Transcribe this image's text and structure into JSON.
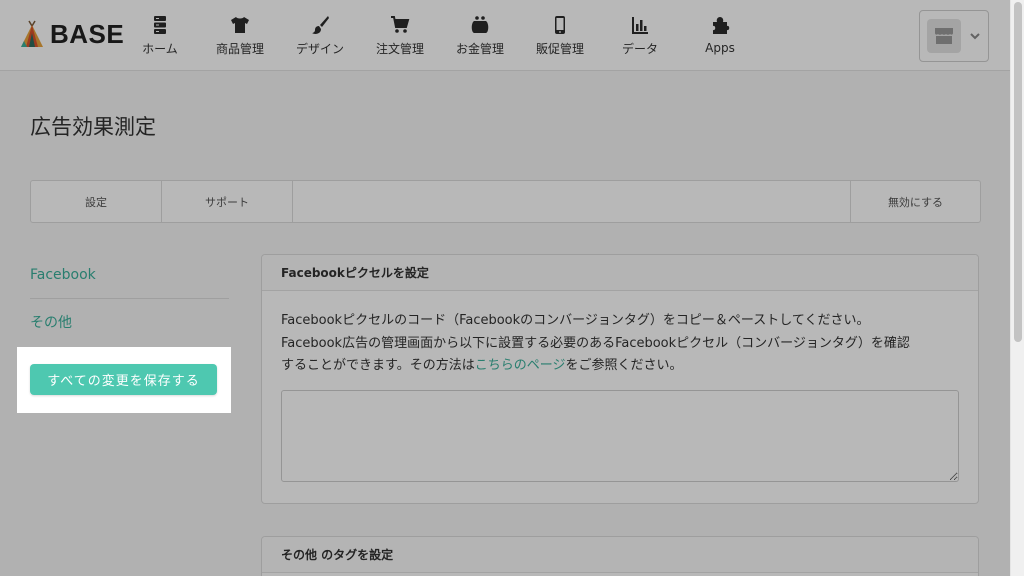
{
  "brand": {
    "name": "BASE"
  },
  "nav": {
    "items": [
      {
        "label": "ホーム",
        "icon": "server-stack-icon"
      },
      {
        "label": "商品管理",
        "icon": "tshirt-icon"
      },
      {
        "label": "デザイン",
        "icon": "paintbrush-icon"
      },
      {
        "label": "注文管理",
        "icon": "cart-icon"
      },
      {
        "label": "お金管理",
        "icon": "purse-icon"
      },
      {
        "label": "販促管理",
        "icon": "smartphone-icon"
      },
      {
        "label": "データ",
        "icon": "bar-chart-icon"
      },
      {
        "label": "Apps",
        "icon": "puzzle-icon"
      }
    ],
    "shop_icon": "storefront-icon"
  },
  "page": {
    "title": "広告効果測定"
  },
  "tabs": {
    "settings": "設定",
    "support": "サポート",
    "disable": "無効にする"
  },
  "sidebar": {
    "items": [
      "Facebook",
      "その他"
    ]
  },
  "save_button": {
    "label": "すべての変更を保存する"
  },
  "panel_facebook": {
    "title": "Facebookピクセルを設定",
    "line1": "Facebookピクセルのコード（Facebookのコンバージョンタグ）をコピー＆ペーストしてください。",
    "line2": "Facebook広告の管理画面から以下に設置する必要のあるFacebookピクセル（コンバージョンタグ）を確認",
    "line3_prefix": "することができます。その方法は",
    "line3_link": "こちらのページ",
    "line3_suffix": "をご参照ください。",
    "code_value": ""
  },
  "panel_other": {
    "title": "その他 のタグを設定"
  },
  "colors": {
    "accent": "#4ec8b0",
    "link": "#3aaf9a"
  }
}
